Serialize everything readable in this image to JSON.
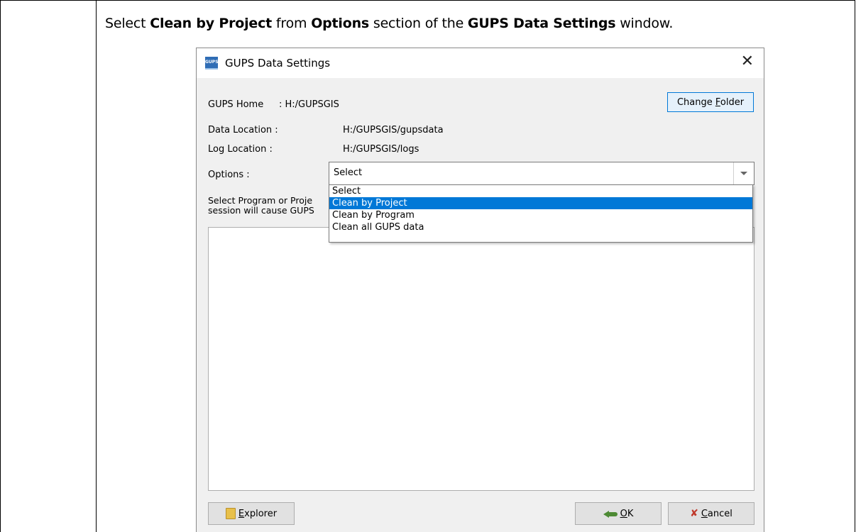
{
  "instruction": {
    "prefix": "Select ",
    "bold1": "Clean by Project",
    "mid1": " from ",
    "bold2": "Options",
    "mid2": " section of the ",
    "bold3": "GUPS Data Settings",
    "suffix": " window."
  },
  "dialog": {
    "icon_text": "GUPS",
    "title": "GUPS Data Settings",
    "close_glyph": "✕",
    "gups_home_label": "GUPS Home",
    "gups_home_value": ": H:/GUPSGIS",
    "change_folder_button": "Change Folder",
    "data_location_label": "Data Location  :",
    "data_location_value": "H:/GUPSGIS/gupsdata",
    "log_location_label": "Log Location  :",
    "log_location_value": "H:/GUPSGIS/logs",
    "options_label": "Options :",
    "options_value": "Select",
    "hint_line1": "Select Program or Proje",
    "hint_line2": "session will cause GUPS",
    "dropdown_items": [
      "Select",
      "Clean by Project",
      "Clean by Program",
      "Clean all GUPS data"
    ],
    "dropdown_selected_index": 1,
    "explorer_button": "Explorer",
    "ok_button": "OK",
    "cancel_button": "Cancel"
  },
  "colors": {
    "accent": "#0078d7",
    "dialog_bg": "#f0f0f0",
    "icon_blue": "#2f6db5"
  },
  "icons": [
    "gups-app-icon",
    "close-icon",
    "dropdown-arrow-icon",
    "folder-icon",
    "ok-arrow-icon",
    "cancel-x-icon"
  ]
}
